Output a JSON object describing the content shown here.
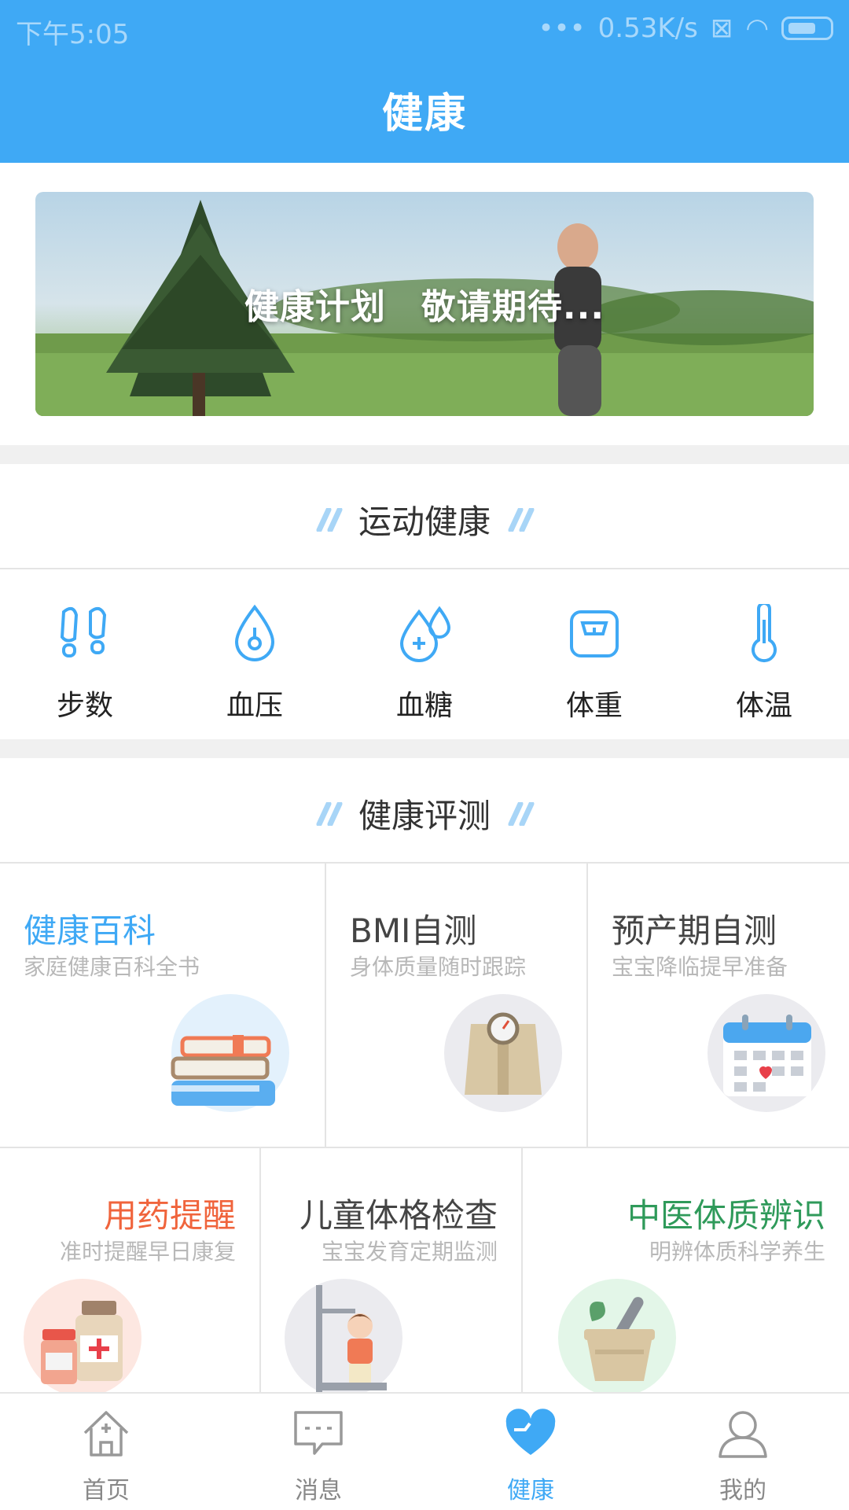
{
  "status_bar": {
    "time": "下午5:05",
    "speed": "0.53K/s"
  },
  "header": {
    "title": "健康"
  },
  "banner": {
    "text": "健康计划　敬请期待..."
  },
  "sports_section": {
    "title": "运动健康",
    "items": [
      {
        "label": "步数",
        "icon": "footprints-icon"
      },
      {
        "label": "血压",
        "icon": "blood-drop-icon"
      },
      {
        "label": "血糖",
        "icon": "blood-sugar-icon"
      },
      {
        "label": "体重",
        "icon": "scale-icon"
      },
      {
        "label": "体温",
        "icon": "thermometer-icon"
      }
    ]
  },
  "assessment_section": {
    "title": "健康评测",
    "cards": [
      {
        "title": "健康百科",
        "subtitle": "家庭健康百科全书",
        "color": "#3fa9f5",
        "icon": "books-icon"
      },
      {
        "title": "BMI自测",
        "subtitle": "身体质量随时跟踪",
        "color": "#444444",
        "icon": "bmi-scale-icon"
      },
      {
        "title": "预产期自测",
        "subtitle": "宝宝降临提早准备",
        "color": "#444444",
        "icon": "calendar-icon"
      },
      {
        "title": "用药提醒",
        "subtitle": "准时提醒早日康复",
        "color": "#f0643c",
        "icon": "medicine-icon"
      },
      {
        "title": "儿童体格检查",
        "subtitle": "宝宝发育定期监测",
        "color": "#444444",
        "icon": "child-height-icon"
      },
      {
        "title": "中医体质辨识",
        "subtitle": "明辨体质科学养生",
        "color": "#2f9a5a",
        "icon": "mortar-icon"
      }
    ]
  },
  "bottom_nav": {
    "items": [
      {
        "label": "首页",
        "icon": "home-icon"
      },
      {
        "label": "消息",
        "icon": "message-icon"
      },
      {
        "label": "健康",
        "icon": "heart-icon",
        "active": true
      },
      {
        "label": "我的",
        "icon": "user-icon"
      }
    ]
  },
  "colors": {
    "primary": "#3fa9f5",
    "divider": "#e4e4e4",
    "subtitle": "#b8b8b8"
  }
}
